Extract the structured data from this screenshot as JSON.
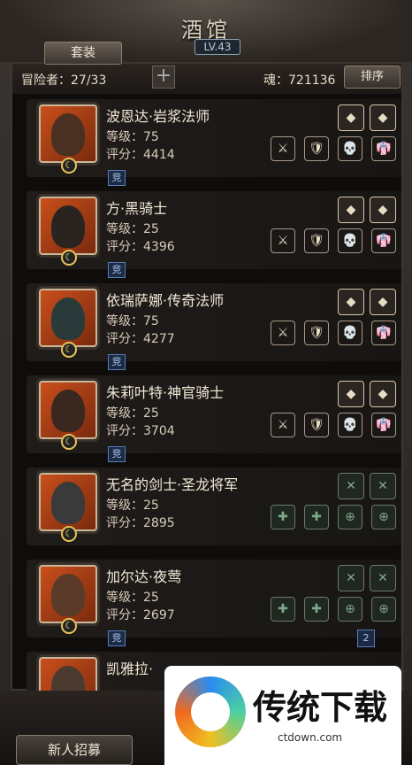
{
  "header": {
    "title": "酒馆",
    "level": "LV.43",
    "outfit_tab": "套装"
  },
  "stats": {
    "adventurers": "冒险者：27/33",
    "soul": "魂：721136",
    "sort_label": "排序",
    "add_icon": "+"
  },
  "heroes": [
    {
      "name": "波恩达·岩浆法师",
      "level": "等级：75",
      "score": "评分：4414",
      "tag": "竞",
      "face": "#4a3020"
    },
    {
      "name": "方·黑骑士",
      "level": "等级：25",
      "score": "评分：4396",
      "tag": "竞",
      "face": "#2a2320"
    },
    {
      "name": "依瑞萨娜·传奇法师",
      "level": "等级：75",
      "score": "评分：4277",
      "tag": "竞",
      "face": "#2a3a3a"
    },
    {
      "name": "朱莉叶特·神官骑士",
      "level": "等级：25",
      "score": "评分：3704",
      "tag": "竞",
      "face": "#3a2820"
    },
    {
      "name": "无名的剑士·圣龙将军",
      "level": "等级：25",
      "score": "评分：2895",
      "tag": "",
      "face": "#3a3a3a"
    },
    {
      "name": "加尔达·夜莺",
      "level": "等级：25",
      "score": "评分：2697",
      "tag": "竞",
      "face": "#5a3a28"
    },
    {
      "name": "凯雅拉·",
      "level": "",
      "score": "",
      "tag": "",
      "face": "#4a3a30"
    }
  ],
  "page_marker": "2",
  "bottom": {
    "recruit_label": "新人招募"
  },
  "ad": {
    "brand": "传统下载",
    "url": "ctdown.com"
  }
}
